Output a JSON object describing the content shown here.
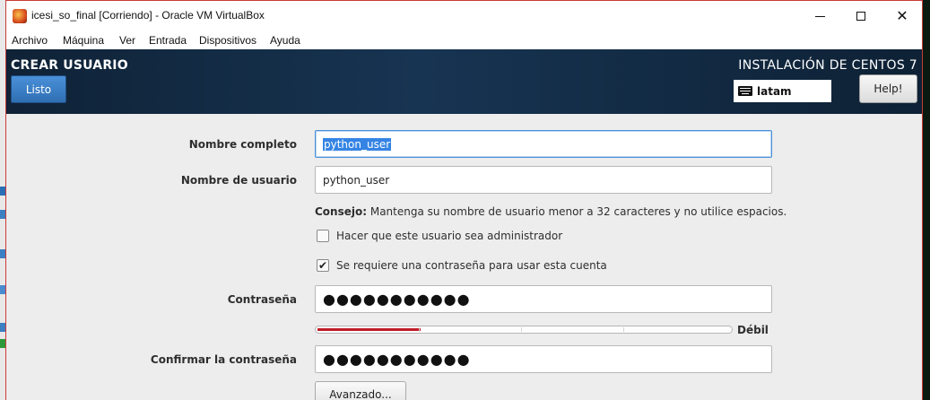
{
  "window": {
    "title": "icesi_so_final [Corriendo] - Oracle VM VirtualBox"
  },
  "menu": [
    "Archivo",
    "Máquina",
    "Ver",
    "Entrada",
    "Dispositivos",
    "Ayuda"
  ],
  "header": {
    "spoke_title": "CREAR USUARIO",
    "done_label": "Listo",
    "install_title": "INSTALACIÓN DE CENTOS 7",
    "keyboard_layout": "latam",
    "keyboard_icon": "keyboard-icon",
    "help_label": "Help!"
  },
  "form": {
    "full_name_label": "Nombre completo",
    "full_name_value": "python_user",
    "username_label": "Nombre de usuario",
    "username_value": "python_user",
    "tip_bold": "Consejo:",
    "tip_text": " Mantenga su nombre de usuario menor a 32 caracteres y no utilice espacios.",
    "admin_label": "Hacer que este usuario sea administrador",
    "admin_checked": false,
    "require_password_label": "Se requiere una contraseña para usar esta cuenta",
    "require_password_checked": true,
    "password_label": "Contraseña",
    "password_value": "●●●●●●●●●●●",
    "strength_text": "Débil",
    "strength_fraction": 0.25,
    "confirm_label": "Confirmar la contraseña",
    "confirm_value": "●●●●●●●●●●●",
    "advanced_label": "Avanzado..."
  },
  "colors": {
    "header_bg": "#173452",
    "done_button": "#3a7dc6",
    "strength_weak": "#c01c28"
  }
}
